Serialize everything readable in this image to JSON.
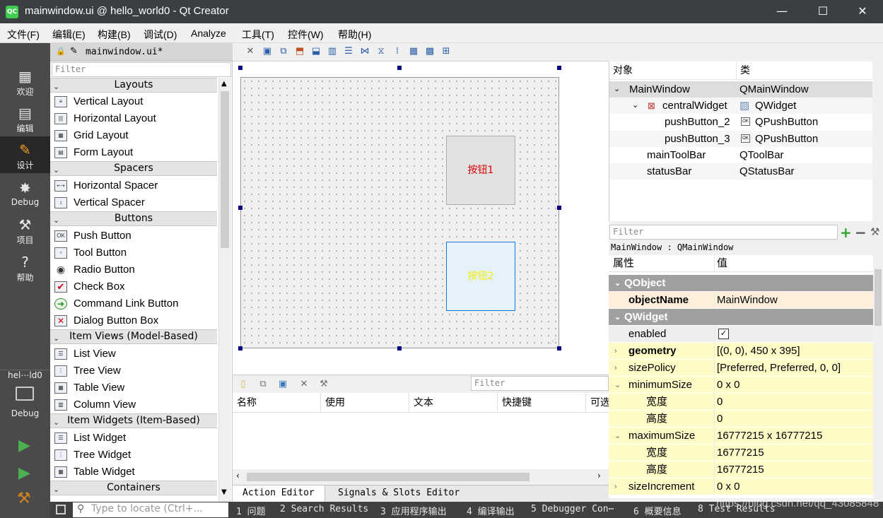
{
  "window": {
    "title": "mainwindow.ui @ hello_world0 - Qt Creator",
    "app_icon": "QC",
    "minimize": "—",
    "maximize": "☐",
    "close": "✕"
  },
  "menu": [
    "文件(F)",
    "编辑(E)",
    "构建(B)",
    "调试(D)",
    "Analyze",
    "工具(T)",
    "控件(W)",
    "帮助(H)"
  ],
  "modes": [
    {
      "label": "欢迎",
      "icon": "grid-icon"
    },
    {
      "label": "编辑",
      "icon": "document-icon"
    },
    {
      "label": "设计",
      "icon": "pencil-icon"
    },
    {
      "label": "Debug",
      "icon": "bug-icon"
    },
    {
      "label": "项目",
      "icon": "wrench-icon"
    },
    {
      "label": "帮助",
      "icon": "help-icon"
    }
  ],
  "kit": {
    "project": "hel⋯ld0",
    "label": "Debug"
  },
  "editor": {
    "file_tab": "mainwindow.ui*"
  },
  "widgetbox": {
    "filter_placeholder": "Filter",
    "categories": {
      "layouts": "Layouts",
      "spacers": "Spacers",
      "buttons": "Buttons",
      "item_views": "Item Views (Model-Based)",
      "item_widgets": "Item Widgets (Item-Based)",
      "containers": "Containers"
    },
    "items": {
      "vertical_layout": "Vertical Layout",
      "horizontal_layout": "Horizontal Layout",
      "grid_layout": "Grid Layout",
      "form_layout": "Form Layout",
      "horizontal_spacer": "Horizontal Spacer",
      "vertical_spacer": "Vertical Spacer",
      "push_button": "Push Button",
      "tool_button": "Tool Button",
      "radio_button": "Radio Button",
      "check_box": "Check Box",
      "command_link_button": "Command Link Button",
      "dialog_button_box": "Dialog Button Box",
      "list_view": "List View",
      "tree_view": "Tree View",
      "table_view": "Table View",
      "column_view": "Column View",
      "list_widget": "List Widget",
      "tree_widget": "Tree Widget",
      "table_widget": "Table Widget"
    }
  },
  "form": {
    "button1": {
      "text": "按钮1",
      "color": "#e00000"
    },
    "button2": {
      "text": "按钮2",
      "color": "#f5f000"
    }
  },
  "action_editor": {
    "filter_placeholder": "Filter",
    "columns": [
      "名称",
      "使用",
      "文本",
      "快捷键",
      "可选"
    ],
    "tabs": [
      "Action Editor",
      "Signals & Slots Editor"
    ]
  },
  "object_inspector": {
    "headers": [
      "对象",
      "类"
    ],
    "rows": [
      {
        "name": "MainWindow",
        "class": "QMainWindow"
      },
      {
        "name": "centralWidget",
        "class": "QWidget"
      },
      {
        "name": "pushButton_2",
        "class": "QPushButton"
      },
      {
        "name": "pushButton_3",
        "class": "QPushButton"
      },
      {
        "name": "mainToolBar",
        "class": "QToolBar"
      },
      {
        "name": "statusBar",
        "class": "QStatusBar"
      }
    ]
  },
  "property_editor": {
    "filter_placeholder": "Filter",
    "class_line": "MainWindow : QMainWindow",
    "headers": [
      "属性",
      "值"
    ],
    "groups": {
      "qobject": "QObject",
      "qwidget": "QWidget"
    },
    "props": {
      "object_name": {
        "name": "objectName",
        "value": "MainWindow"
      },
      "enabled": {
        "name": "enabled",
        "value": "✓"
      },
      "geometry": {
        "name": "geometry",
        "value": "[(0, 0), 450 x 395]"
      },
      "size_policy": {
        "name": "sizePolicy",
        "value": "[Preferred, Preferred, 0, 0]"
      },
      "minimum_size": {
        "name": "minimumSize",
        "value": "0 x 0"
      },
      "min_width": {
        "name": "宽度",
        "value": "0"
      },
      "min_height": {
        "name": "高度",
        "value": "0"
      },
      "maximum_size": {
        "name": "maximumSize",
        "value": "16777215 x 16777215"
      },
      "max_width": {
        "name": "宽度",
        "value": "16777215"
      },
      "max_height": {
        "name": "高度",
        "value": "16777215"
      },
      "size_increment": {
        "name": "sizeIncrement",
        "value": "0 x 0"
      }
    }
  },
  "statusbar": {
    "locate_placeholder": "Type to locate (Ctrl+...",
    "items": [
      "1 问题",
      "2 Search Results",
      "3 应用程序输出",
      "4 编译输出",
      "5 Debugger Con⋯",
      "6 概要信息",
      "8 Test Results"
    ]
  },
  "watermark": "https://blog.csdn.net/qq_43085848"
}
